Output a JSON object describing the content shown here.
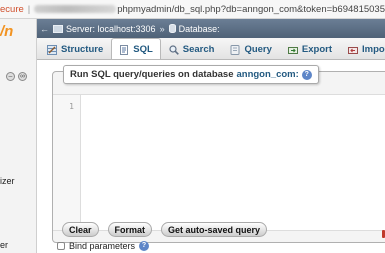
{
  "browser": {
    "secure_label": "ecure",
    "separator": "|",
    "url_path": "phpmyadmin/db_sql.php?db=anngon_com&token=b694815035"
  },
  "left_panel": {
    "logo_fragment": "/n",
    "text_fragment": "izer",
    "text_fragment2": "er"
  },
  "breadcrumb": {
    "server_label": "Server: localhost:3306",
    "database_label": "Database:"
  },
  "tabs": [
    {
      "label": "Structure",
      "icon": "structure-icon",
      "active": false
    },
    {
      "label": "SQL",
      "icon": "sql-icon",
      "active": true
    },
    {
      "label": "Search",
      "icon": "search-icon",
      "active": false
    },
    {
      "label": "Query",
      "icon": "query-icon",
      "active": false
    },
    {
      "label": "Export",
      "icon": "export-icon",
      "active": false
    },
    {
      "label": "Import",
      "icon": "import-icon",
      "active": false
    }
  ],
  "sql_panel": {
    "legend_prefix": "Run SQL query/queries on database",
    "database_name": "anngon_com:",
    "line_number": "1",
    "query_text": ""
  },
  "buttons": {
    "clear": "Clear",
    "format": "Format",
    "get_autosaved": "Get auto-saved query"
  },
  "bind_parameters": {
    "label": "Bind parameters",
    "checked": false
  },
  "colors": {
    "tab_text": "#235a81",
    "breadcrumb_bg": "#5a6d84",
    "secure_text": "#d0502d",
    "logo_orange": "#f29321"
  }
}
